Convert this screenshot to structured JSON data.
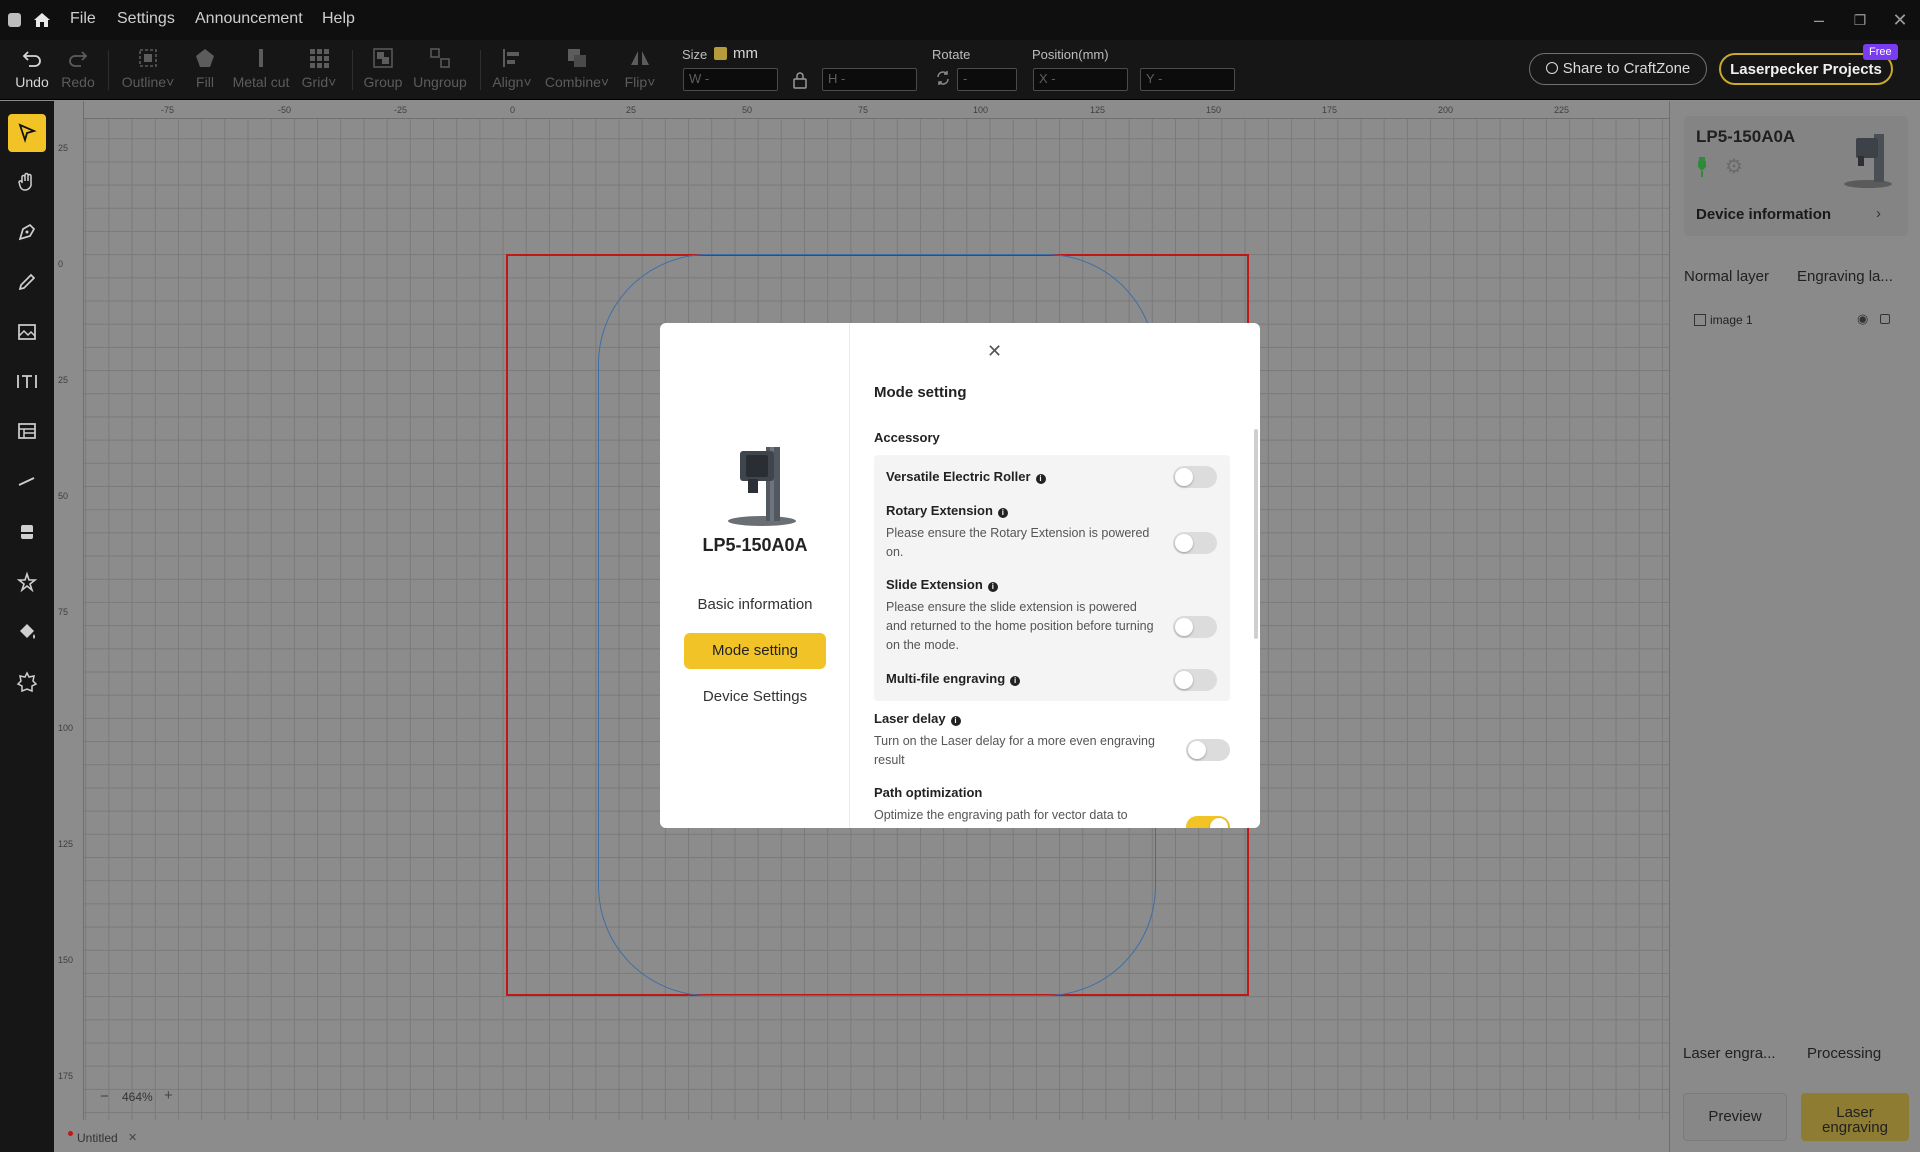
{
  "menu": [
    "File",
    "Settings",
    "Announcement",
    "Help"
  ],
  "toolbar": {
    "undo": "Undo",
    "redo": "Redo",
    "outline": "Outline",
    "fill": "Fill",
    "metal_cut": "Metal cut",
    "grid": "Grid",
    "group": "Group",
    "ungroup": "Ungroup",
    "align": "Align",
    "combine": "Combine",
    "flip": "Flip",
    "size_label": "Size",
    "unit": "mm",
    "w_placeholder": "W -",
    "h_placeholder": "H -",
    "rotate_label": "Rotate",
    "rotate_placeholder": "-",
    "position_label": "Position(mm)",
    "x_placeholder": "X -",
    "y_placeholder": "Y -",
    "share": "Share to CraftZone",
    "projects": "Laserpecker Projects",
    "free_badge": "Free"
  },
  "ruler": {
    "top": [
      "-75",
      "-50",
      "-25",
      "0",
      "25",
      "50",
      "75",
      "100",
      "125",
      "150",
      "175",
      "200",
      "225"
    ],
    "left": [
      "25",
      "0",
      "25",
      "50",
      "75",
      "100",
      "125",
      "150",
      "175"
    ]
  },
  "zoom": "464%",
  "tab_name": "Untitled",
  "right_panel": {
    "device_name": "LP5-150A0A",
    "device_info": "Device information",
    "tabs": [
      "Normal layer",
      "Engraving la..."
    ],
    "layer_item": "image 1",
    "bottom_tabs": [
      "Laser engra...",
      "Processing"
    ],
    "preview": "Preview",
    "laser_engraving": "Laser engraving"
  },
  "modal": {
    "device_name": "LP5-150A0A",
    "nav": [
      "Basic information",
      "Mode setting",
      "Device Settings"
    ],
    "title": "Mode setting",
    "accessory_title": "Accessory",
    "rows": [
      {
        "title": "Versatile Electric Roller",
        "desc": "",
        "on": false
      },
      {
        "title": "Rotary Extension",
        "desc": "Please ensure the Rotary Extension is powered on.",
        "on": false
      },
      {
        "title": "Slide Extension",
        "desc": "Please ensure the slide extension is powered and returned to the home position before turning on the mode.",
        "on": false
      },
      {
        "title": "Multi-file engraving",
        "desc": "",
        "on": false
      }
    ],
    "laser_delay": {
      "title": "Laser delay",
      "desc": "Turn on the Laser delay for a more even engraving result",
      "on": false
    },
    "path_opt": {
      "title": "Path optimization",
      "desc": "Optimize the engraving path for vector data to",
      "on": true
    }
  }
}
